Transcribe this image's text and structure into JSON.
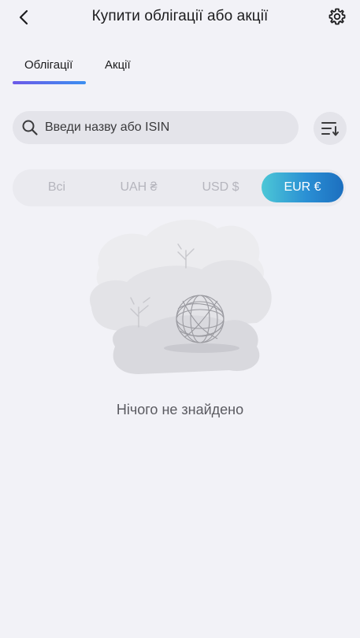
{
  "header": {
    "title": "Купити облігації або акції",
    "back_icon": "chevron-left-icon",
    "settings_icon": "gear-icon"
  },
  "tabs": [
    {
      "label": "Облігації",
      "active": true
    },
    {
      "label": "Акції",
      "active": false
    }
  ],
  "search": {
    "placeholder": "Введи назву або ISIN",
    "value": ""
  },
  "sort_icon": "sort-icon",
  "currency_filter": {
    "options": [
      "Всі",
      "UAH ₴",
      "USD $",
      "EUR €"
    ],
    "selected": "EUR €"
  },
  "empty_state": {
    "illustration_icon": "tumbleweed-icon",
    "message": "Нічого не знайдено"
  },
  "colors": {
    "background": "#f2f2f7",
    "accent_start": "#4cc7d6",
    "accent_end": "#1c6fbf",
    "tab_underline_start": "#6c59e8",
    "tab_underline_end": "#3b8ff0"
  }
}
